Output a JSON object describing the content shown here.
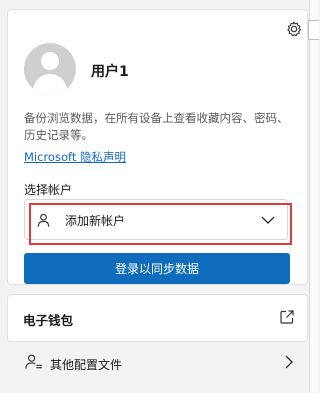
{
  "profile": {
    "name": "用户1",
    "description": "备份浏览数据，在所有设备上查看收藏内容、密码、历史记录等。",
    "privacy_link": "Microsoft 隐私声明"
  },
  "account_select": {
    "section_label": "选择帐户",
    "selected": "添加新帐户"
  },
  "sync_button": "登录以同步数据",
  "wallet": {
    "label": "电子钱包"
  },
  "other_profiles": {
    "label": "其他配置文件"
  },
  "colors": {
    "accent": "#0f6cbd",
    "highlight": "#e03a3a",
    "background": "#f3f3f3"
  },
  "icons": [
    "gear-icon",
    "avatar-icon",
    "person-icon",
    "chevron-down-icon",
    "external-link-icon",
    "profiles-icon",
    "chevron-right-icon"
  ]
}
